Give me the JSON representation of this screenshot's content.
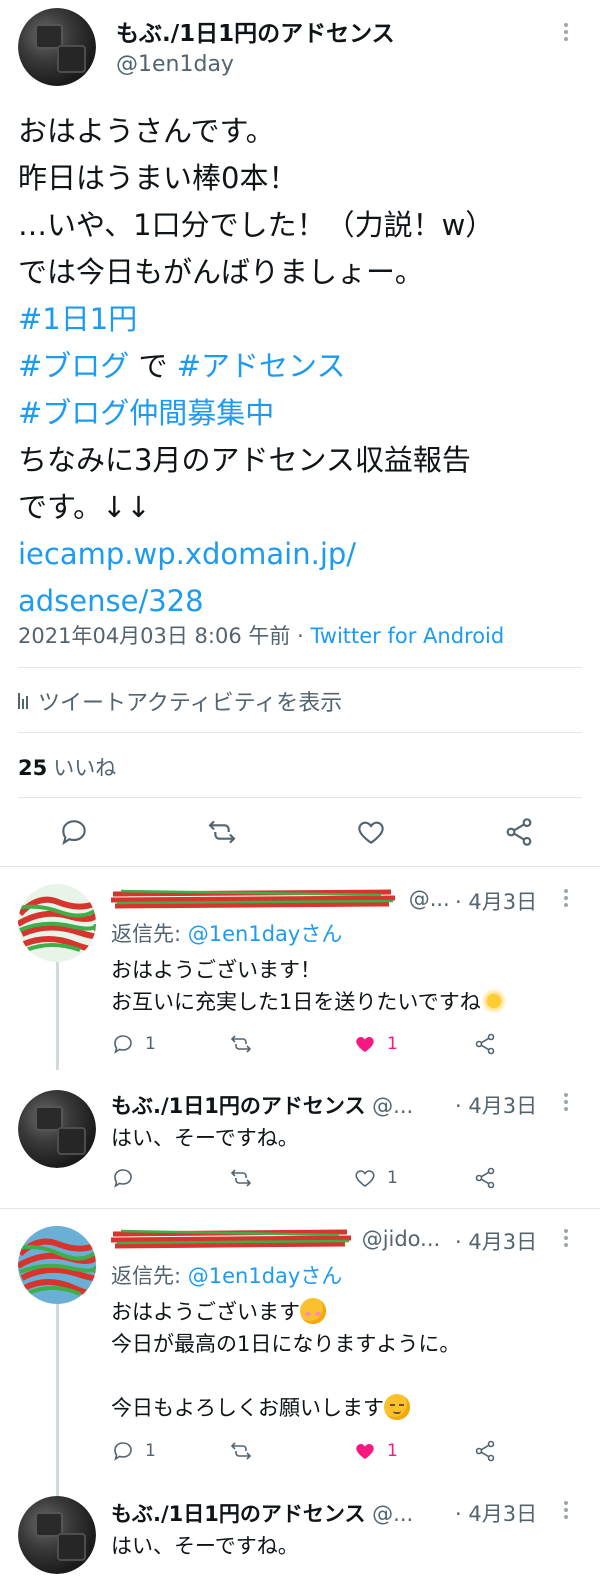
{
  "main_tweet": {
    "display_name": "もぶ./1日1円のアドセンス",
    "handle": "@1en1day",
    "lines": [
      "おはようさんです。",
      "昨日はうまい棒0本！",
      "…いや、1口分でした！（力説！w）",
      "では今日もがんばりましょー。"
    ],
    "hashtag_1": "#1日1円",
    "hashtag_2": "#ブログ",
    "connector": " で ",
    "hashtag_3": "#アドセンス",
    "hashtag_4": "#ブログ仲間募集中",
    "line_after_1": "ちなみに3月のアドセンス収益報告",
    "line_after_2": "です。↓↓",
    "link_1": "iecamp.wp.xdomain.jp/",
    "link_2": "adsense/328",
    "timestamp": "2021年04月03日 8:06 午前 · ",
    "source": "Twitter for Android",
    "activity_label": "ツイートアクティビティを表示",
    "like_count": "25",
    "like_label": "いいね"
  },
  "replies": [
    {
      "display_name": "（塗りつぶし）",
      "handle": "@...",
      "date": "· 4月3日",
      "reply_to_prefix": "返信先: ",
      "reply_to": "@1en1dayさん",
      "lines": [
        "おはようございます！",
        "お互いに充実した1日を送りたいですね"
      ],
      "reply_count": "1",
      "retweet_count": "",
      "like_count": "1",
      "liked": true
    },
    {
      "display_name": "もぶ./1日1円のアドセンス",
      "handle": "@...",
      "date": "· 4月3日",
      "lines": [
        "はい、そーですね。"
      ],
      "reply_count": "",
      "retweet_count": "",
      "like_count": "1",
      "liked": false
    },
    {
      "display_name": "（塗りつぶし）",
      "handle": "@jido...",
      "date": "· 4月3日",
      "reply_to_prefix": "返信先: ",
      "reply_to": "@1en1dayさん",
      "lines": [
        "おはようございます",
        "今日が最高の1日になりますように。",
        "",
        "今日もよろしくお願いします"
      ],
      "reply_count": "1",
      "retweet_count": "",
      "like_count": "1",
      "liked": true
    },
    {
      "display_name": "もぶ./1日1円のアドセンス",
      "handle": "@...",
      "date": "· 4月3日",
      "lines": [
        "はい、そーですね。"
      ]
    }
  ],
  "colors": {
    "link": "#1d9bf0",
    "secondary_text": "#536471",
    "like_red": "#f91880",
    "divider": "#e1e8ed"
  },
  "icons": [
    "more-vertical-icon",
    "analytics-icon",
    "reply-icon",
    "retweet-icon",
    "like-icon",
    "share-icon",
    "sun-emoji",
    "blush-emoji",
    "relieved-emoji"
  ]
}
